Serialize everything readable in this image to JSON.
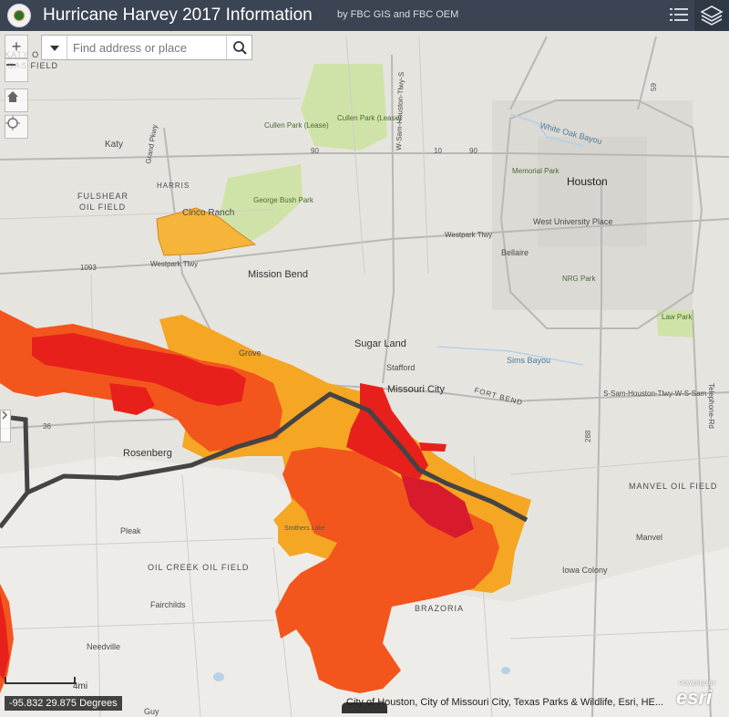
{
  "header": {
    "title": "Hurricane Harvey 2017 Information",
    "subtitle": "by FBC GIS and FBC OEM"
  },
  "search": {
    "placeholder": "Find address or place"
  },
  "zoom": {
    "in": "+"
  },
  "status": {
    "coordinates": "-95.832 29.875 Degrees",
    "scale": "4mi",
    "attribution": "City of Houston, City of Missouri City, Texas Parks & Wildlife, Esri, HE...",
    "esri": "esri",
    "powered": "POWERED BY"
  },
  "map_labels": {
    "katy_oil_gas": "KATY O",
    "gas_field": "GAS FIELD",
    "katy": "Katy",
    "fulshear": "FULSHEAR",
    "oil_field": "OIL FIELD",
    "grand_pkwy": "Grand Pkwy",
    "harris": "HARRIS",
    "cinco_ranch": "Cinco Ranch",
    "george_bush_park": "George Bush Park",
    "cullen_park_1": "Cullen Park (Lease)",
    "cullen_park_2": "Cullen Park (Lease)",
    "houston": "Houston",
    "memorial_park": "Memorial Park",
    "white_oak_bayou": "White Oak Bayou",
    "west_university_place": "West University Place",
    "bellaire": "Bellaire",
    "nrg_park": "NRG Park",
    "westpark_tlwy_1": "Westpark Tlwy",
    "westpark_tlwy_2": "Westpark Tlwy",
    "mission_bend": "Mission Bend",
    "sugar_land": "Sugar Land",
    "stafford": "Stafford",
    "missouri_city": "Missouri City",
    "first_colony": "Grove",
    "rosenberg": "Rosenberg",
    "fort_bend": "FORT BEND",
    "sims_bayou": "Sims Bayou",
    "law_park": "Law Park",
    "manvel_oil_field": "MANVEL OIL FIELD",
    "manvel": "Manvel",
    "iowa_colony": "Iowa Colony",
    "brazoria": "BRAZORIA",
    "pleak": "Pleak",
    "oil_creek_oil_field": "OIL CREEK OIL FIELD",
    "fairchilds": "Fairchilds",
    "needville": "Needville",
    "guy": "Guy",
    "s_sam_houston": "S-Sam-Houston-Tlwy-W-S-Sam",
    "w_sam_houston": "W-Sam-Houston-Tlwy-S",
    "telephone_rd": "Telephone-Rd",
    "hwy_90": "90",
    "hwy_10": "10",
    "hwy_90b": "90",
    "hwy_1093": "1093",
    "hwy_36": "36",
    "hwy_288": "288",
    "hwy_59": "59",
    "smithers_lake": "Smithers Lake"
  },
  "colors": {
    "header": "#3a4453",
    "flood_high": "#e8201c",
    "flood_mid": "#f2561d",
    "flood_low": "#f5a623",
    "flood_cinco": "#f7b43a",
    "park_green": "#cfe3a8",
    "levee_line": "#444444"
  }
}
